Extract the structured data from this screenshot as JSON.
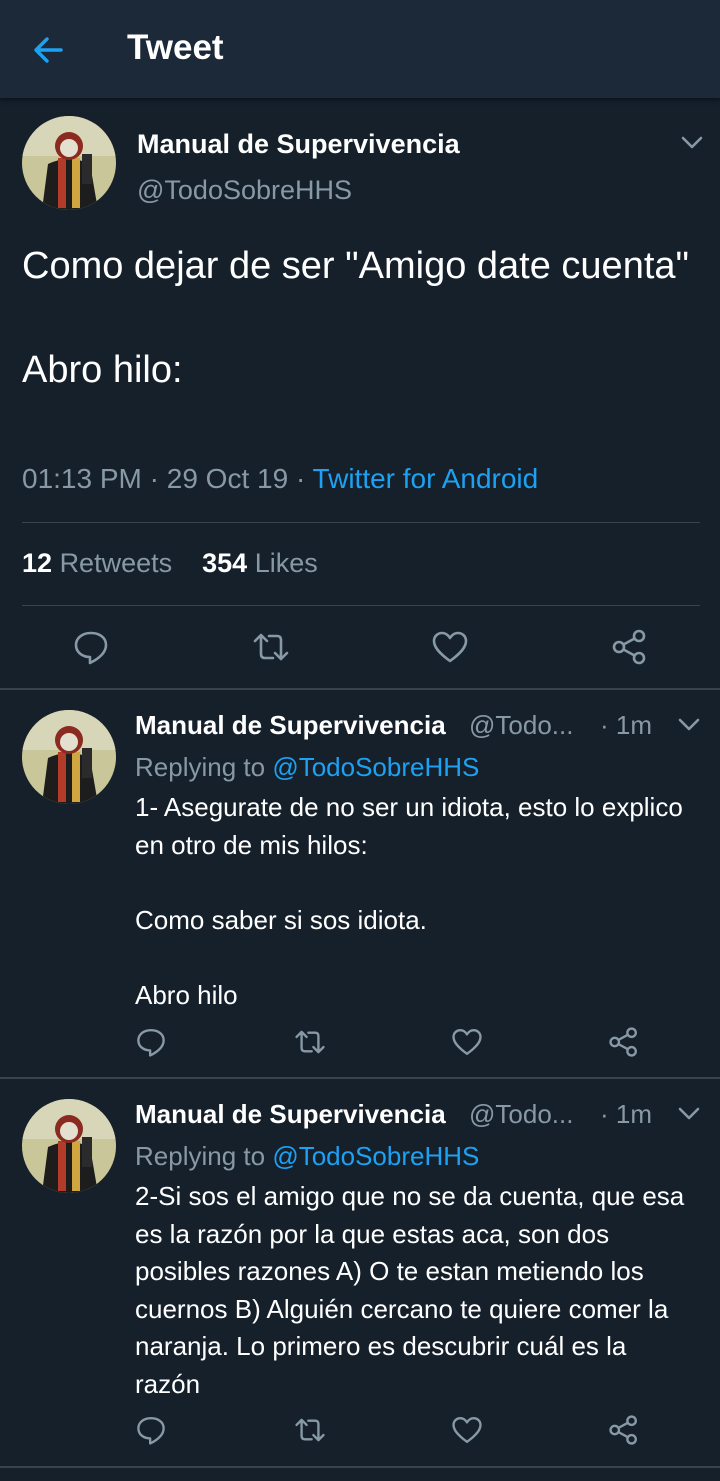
{
  "appbar": {
    "title": "Tweet"
  },
  "main_tweet": {
    "display_name": "Manual de Supervivencia",
    "handle": "@TodoSobreHHS",
    "text": "Como dejar de ser \"Amigo date cuenta\"\n\nAbro hilo:",
    "time": "01:13 PM",
    "date": "29 Oct 19",
    "separator": "·",
    "source": "Twitter for Android",
    "retweets_count": "12",
    "retweets_label": "Retweets",
    "likes_count": "354",
    "likes_label": "Likes"
  },
  "replies": [
    {
      "display_name": "Manual de Supervivencia",
      "handle": "@Todo...",
      "time": "· 1m",
      "replying_prefix": "Replying to",
      "replying_to": "@TodoSobreHHS",
      "text": "1- Asegurate de no ser un idiota, esto lo explico en otro de mis hilos:\n\nComo saber si sos idiota.\n\nAbro hilo"
    },
    {
      "display_name": "Manual de Supervivencia",
      "handle": "@Todo...",
      "time": "· 1m",
      "replying_prefix": "Replying to",
      "replying_to": "@TodoSobreHHS",
      "text": "2-Si sos el amigo que no se da cuenta, que esa es la razón por la que estas aca, son dos posibles razones A) O te estan metiendo los cuernos B) Alguién cercano te quiere comer la naranja. Lo primero es descubrir cuál es la razón"
    }
  ],
  "icons": [
    "back-arrow-icon",
    "chevron-down-icon",
    "reply-icon",
    "retweet-icon",
    "like-icon",
    "share-icon"
  ],
  "colors": {
    "background": "#15202b",
    "appbar": "#1c2938",
    "accent": "#1da1f2",
    "secondary_text": "#8899a6",
    "divider": "#38444d"
  }
}
